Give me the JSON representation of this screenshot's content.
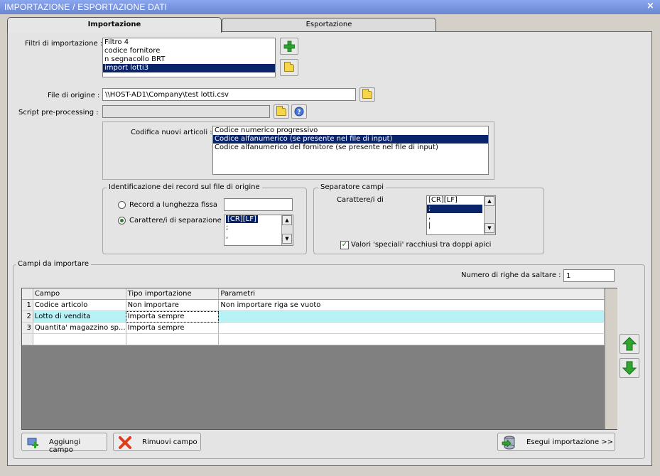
{
  "window": {
    "title": "IMPORTAZIONE / ESPORTAZIONE DATI",
    "close_glyph": "×"
  },
  "tabs": [
    {
      "label": "Importazione",
      "active": true
    },
    {
      "label": "Esportazione",
      "active": false
    }
  ],
  "filters": {
    "label": "Filtri di importazione :",
    "items": [
      "Filtro 4",
      "codice fornitore",
      "n segnacollo BRT",
      "import lotti3"
    ],
    "selected_index": 3
  },
  "source_file": {
    "label": "File di origine :",
    "value": "\\\\HOST-AD1\\Company\\test lotti.csv"
  },
  "script": {
    "label": "Script pre-processing :",
    "value": ""
  },
  "coding": {
    "label": "Codifica nuovi articoli :",
    "options": [
      "Codice numerico progressivo",
      "Codice alfanumerico (se presente nel file di input)",
      "Codice alfanumerico del fornitore (se presente nel file di input)"
    ],
    "selected_index": 1
  },
  "record_id": {
    "group_label": "Identificazione dei record sul file di origine",
    "fixed_label": "Record a lunghezza fissa",
    "fixed_value": "",
    "sep_label": "Carattere/i di separazione",
    "sep_items": [
      "[CR][LF]",
      ";",
      ","
    ],
    "selected": "sep"
  },
  "field_sep": {
    "group_label": "Separatore campi",
    "chars_label": "Carattere/i di",
    "items": [
      "[CR][LF]",
      ";",
      ",",
      "|"
    ],
    "selected_index": 1,
    "quotes_label": "Valori 'speciali' racchiusi tra doppi apici",
    "quotes_checked": true
  },
  "fields": {
    "group_label": "Campi da importare",
    "skip_label": "Numero di righe da saltare :",
    "skip_value": "1",
    "columns": [
      "Campo",
      "Tipo importazione",
      "Parametri"
    ],
    "rows": [
      {
        "n": "1",
        "campo": "Codice articolo",
        "tipo": "Non importare",
        "param": "Non importare riga se vuoto"
      },
      {
        "n": "2",
        "campo": "Lotto di vendita",
        "tipo": "Importa sempre",
        "param": ""
      },
      {
        "n": "3",
        "campo": "Quantita' magazzino sp...",
        "tipo": "Importa sempre",
        "param": ""
      }
    ]
  },
  "buttons": {
    "add_field": "Aggiungi campo",
    "remove_field": "Rimuovi campo",
    "run_import": "Esegui importazione >>"
  },
  "colors": {
    "selection": "#0a246a",
    "highlight_row": "#b7f3f6",
    "grid_empty": "#808080",
    "green": "#2ea52e"
  }
}
